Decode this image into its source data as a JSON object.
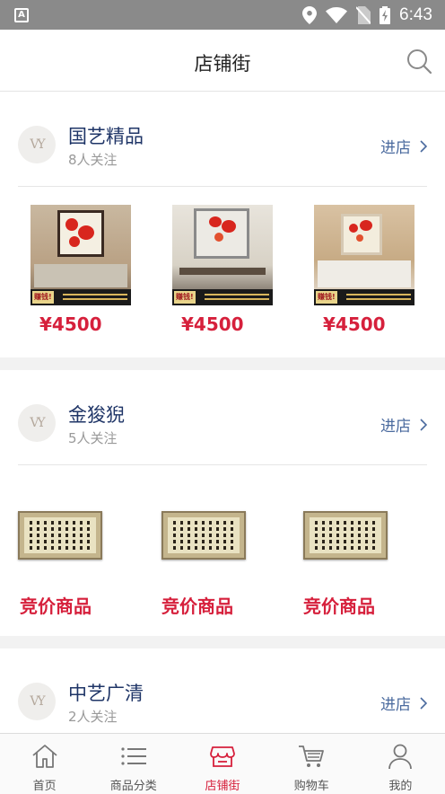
{
  "status_bar": {
    "time": "6:43"
  },
  "header": {
    "title": "店铺街"
  },
  "shops": [
    {
      "name": "国艺精品",
      "followers": "8人关注",
      "enter_label": "进店",
      "products": [
        {
          "price": "¥4500",
          "banner_tag": "赚钱!"
        },
        {
          "price": "¥4500",
          "banner_tag": "赚钱!"
        },
        {
          "price": "¥4500",
          "banner_tag": "赚钱!"
        }
      ]
    },
    {
      "name": "金狻猊",
      "followers": "5人关注",
      "enter_label": "进店",
      "products": [
        {
          "label": "竞价商品"
        },
        {
          "label": "竞价商品"
        },
        {
          "label": "竞价商品"
        }
      ]
    },
    {
      "name": "中艺广清",
      "followers": "2人关注",
      "enter_label": "进店"
    }
  ],
  "tabbar": {
    "items": [
      {
        "label": "首页",
        "icon": "home-icon"
      },
      {
        "label": "商品分类",
        "icon": "list-icon"
      },
      {
        "label": "店铺街",
        "icon": "shop-icon",
        "active": true
      },
      {
        "label": "购物车",
        "icon": "cart-icon"
      },
      {
        "label": "我的",
        "icon": "user-icon"
      }
    ],
    "active_color": "#d6203c"
  },
  "colors": {
    "price": "#d6203c",
    "shop_name": "#1f3567",
    "enter_link": "#4a6a9e",
    "status_bar": "#8a8a8a"
  }
}
